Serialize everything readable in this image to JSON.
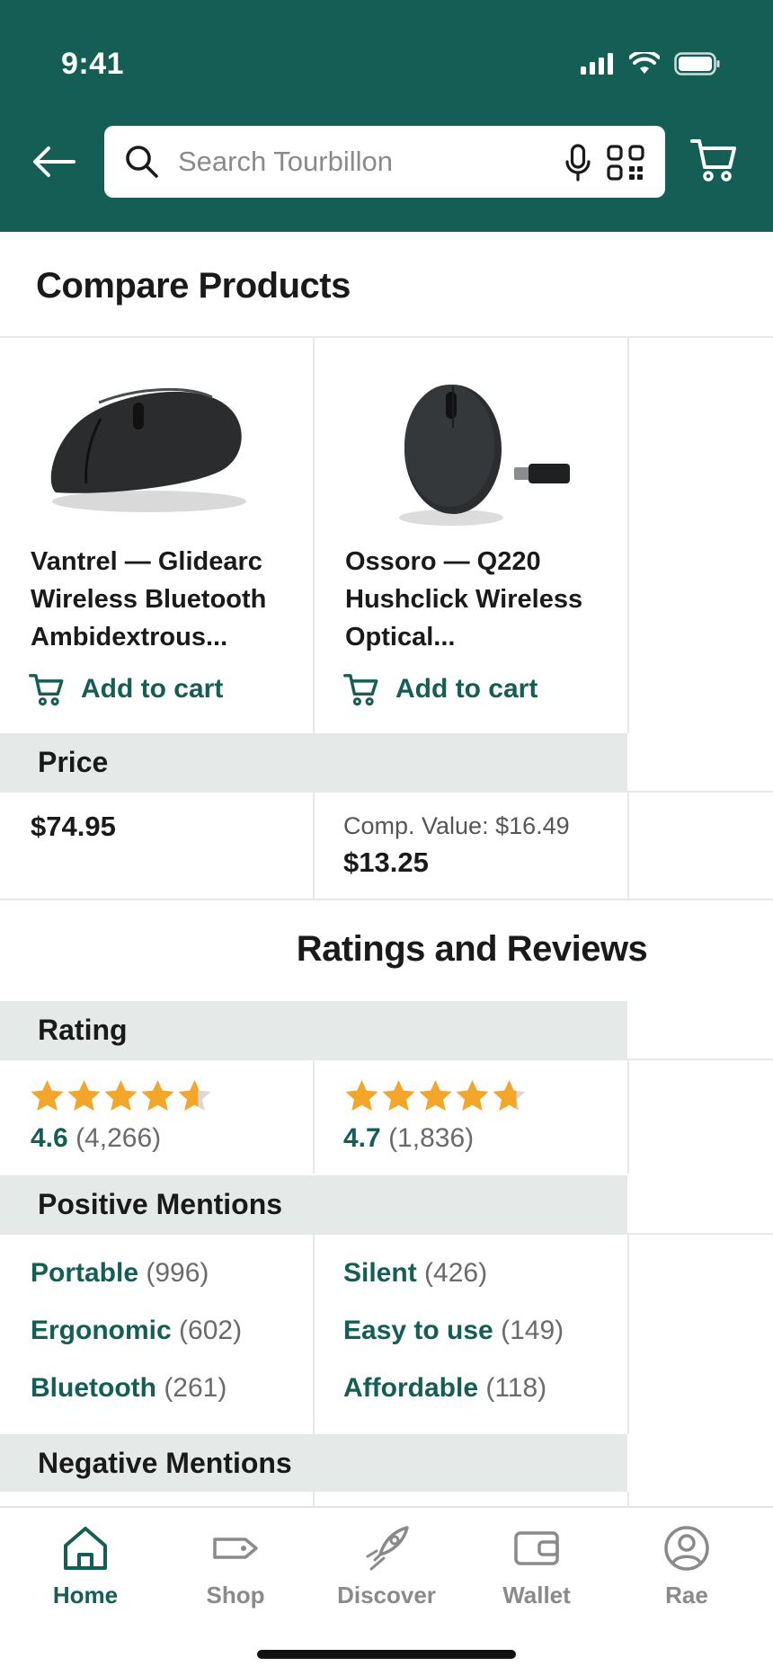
{
  "status_bar": {
    "time": "9:41"
  },
  "search": {
    "placeholder": "Search Tourbillon"
  },
  "page": {
    "title": "Compare Products"
  },
  "products": [
    {
      "name": "Vantrel — Glidearc Wireless Bluetooth Ambidextrous...",
      "add_to_cart": "Add to cart",
      "price": "$74.95",
      "comp_value": "",
      "rating": "4.6",
      "rating_value": 4.6,
      "rating_count": "(4,266)",
      "positive_mentions": [
        {
          "term": "Portable",
          "count": "(996)"
        },
        {
          "term": "Ergonomic",
          "count": "(602)"
        },
        {
          "term": "Bluetooth",
          "count": "(261)"
        }
      ]
    },
    {
      "name": "Ossoro — Q220 Hushclick Wireless Optical...",
      "add_to_cart": "Add to cart",
      "price": "$13.25",
      "comp_value": "Comp. Value: $16.49",
      "rating": "4.7",
      "rating_value": 4.7,
      "rating_count": "(1,836)",
      "positive_mentions": [
        {
          "term": "Silent",
          "count": "(426)"
        },
        {
          "term": "Easy to use",
          "count": "(149)"
        },
        {
          "term": "Affordable",
          "count": "(118)"
        }
      ]
    }
  ],
  "sections": {
    "price": "Price",
    "ratings_reviews": "Ratings and Reviews",
    "rating": "Rating",
    "positive_mentions": "Positive Mentions",
    "negative_mentions": "Negative Mentions"
  },
  "tabs": [
    {
      "label": "Home",
      "icon": "home-icon",
      "active": true
    },
    {
      "label": "Shop",
      "icon": "tag-icon",
      "active": false
    },
    {
      "label": "Discover",
      "icon": "rocket-icon",
      "active": false
    },
    {
      "label": "Wallet",
      "icon": "wallet-icon",
      "active": false
    },
    {
      "label": "Rae",
      "icon": "profile-icon",
      "active": false
    }
  ],
  "colors": {
    "brand": "#145e55",
    "star": "#f4a62a",
    "band": "#e5e9e8"
  }
}
